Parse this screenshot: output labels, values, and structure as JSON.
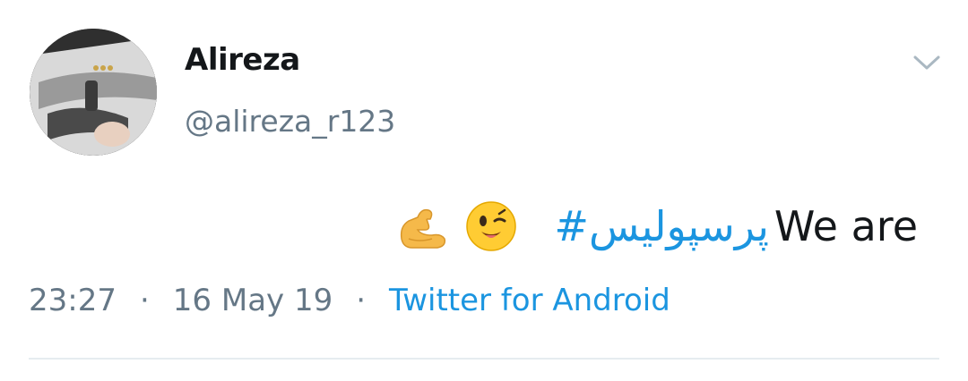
{
  "author": {
    "display_name": "Alireza",
    "handle": "@alireza_r123"
  },
  "menu": {
    "icon": "chevron-down-icon"
  },
  "tweet": {
    "text": "We are ",
    "hashtag": "#پرسپولیس",
    "emojis": [
      "winking-face-icon",
      "flexed-biceps-icon"
    ]
  },
  "meta": {
    "time": "23:27",
    "separator": "·",
    "date": "16 May 19",
    "source": "Twitter for Android"
  },
  "colors": {
    "text": "#14171a",
    "secondary": "#657786",
    "link": "#1b95e0",
    "divider": "#e6ecf0"
  }
}
